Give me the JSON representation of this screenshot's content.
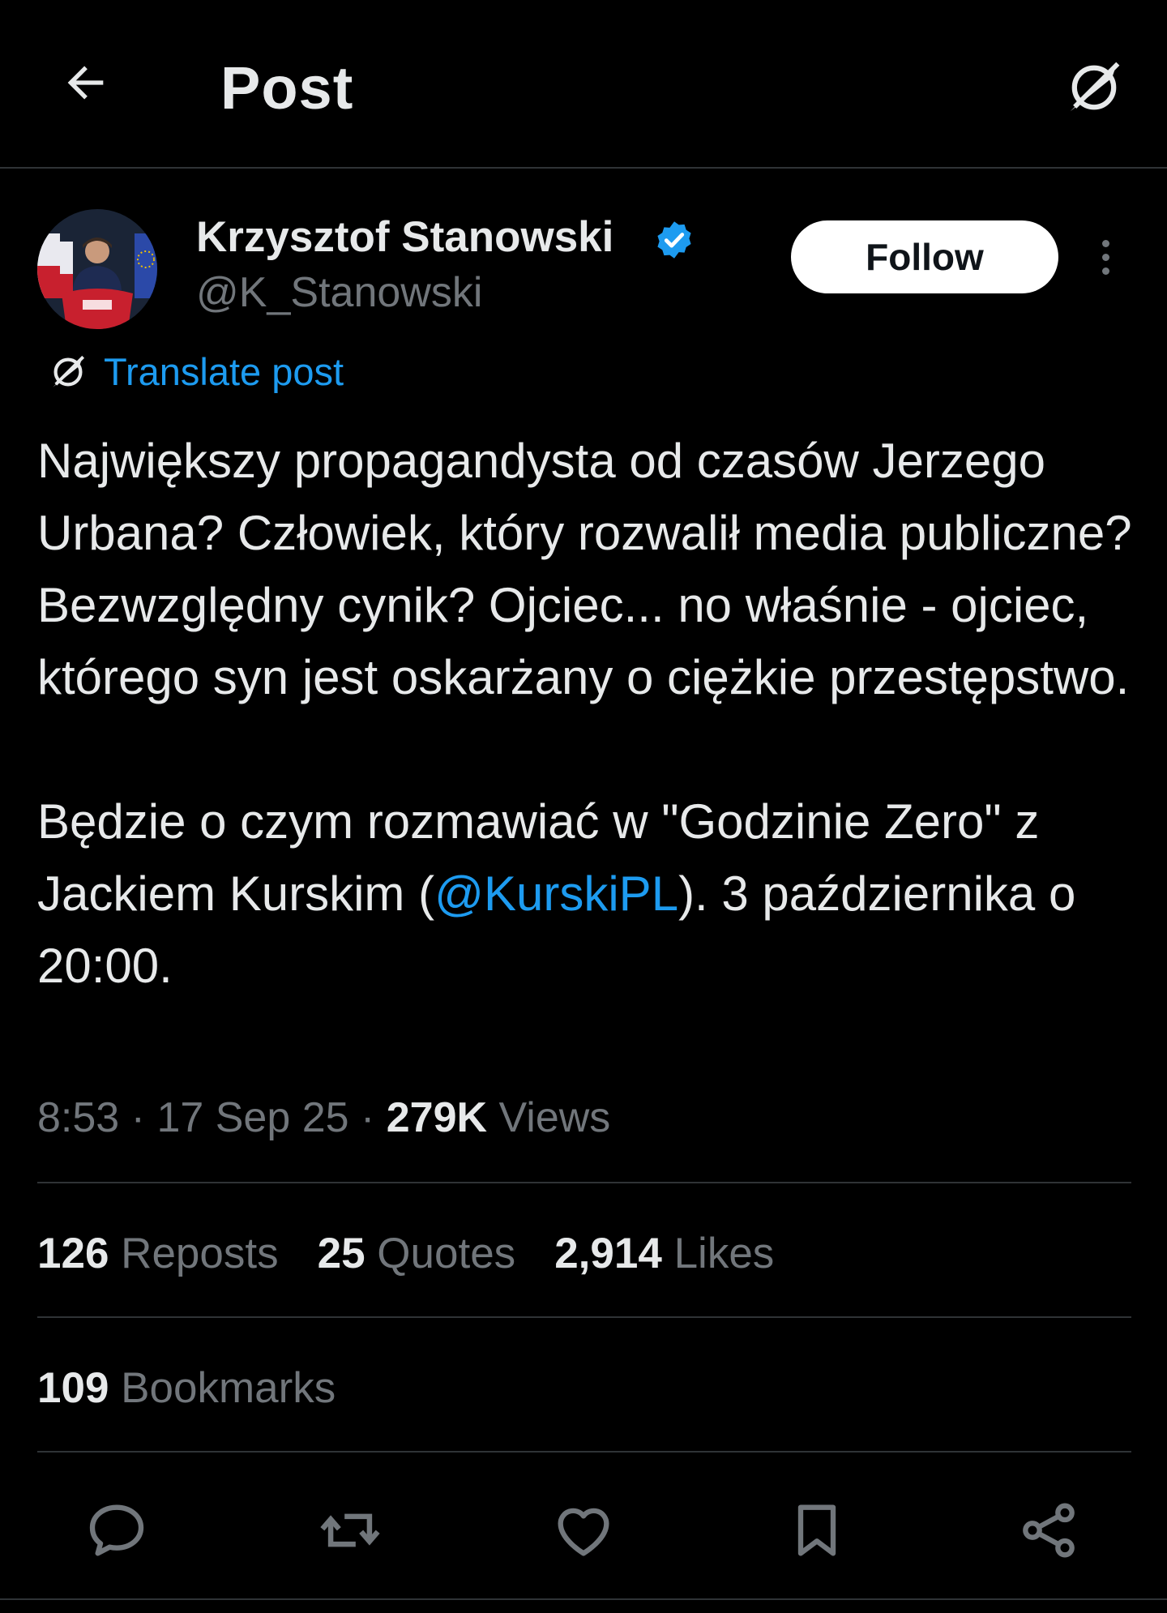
{
  "header": {
    "title": "Post",
    "back_icon": "arrow-left-icon",
    "translate_icon": "translate-icon"
  },
  "author": {
    "name": "Krzysztof Stanowski",
    "handle": "@K_Stanowski",
    "verified": true,
    "follow_label": "Follow"
  },
  "translate": {
    "label": "Translate post"
  },
  "post": {
    "paragraph_1": "Największy propagandysta od czasów Jerzego Urbana? Człowiek, który rozwalił media publiczne? Bezwzględny cynik? Ojciec... no właśnie - ojciec, którego syn jest oskarżany o ciężkie przestępstwo.",
    "paragraph_2_before": "Będzie o czym rozmawiać w \"Godzinie Zero\" z Jackiem Kurskim (",
    "mention": "@KurskiPL",
    "paragraph_2_after": "). 3 października o 20:00."
  },
  "meta": {
    "time": "8:53",
    "date": "17 Sep 25",
    "views_count": "279K",
    "views_label": "Views"
  },
  "stats": {
    "reposts_count": "126",
    "reposts_label": "Reposts",
    "quotes_count": "25",
    "quotes_label": "Quotes",
    "likes_count": "2,914",
    "likes_label": "Likes",
    "bookmarks_count": "109",
    "bookmarks_label": "Bookmarks"
  },
  "actions": [
    "reply-icon",
    "repost-icon",
    "like-icon",
    "bookmark-icon",
    "share-icon"
  ],
  "colors": {
    "background": "#000000",
    "text": "#e7e9ea",
    "muted": "#71767b",
    "link": "#1d9bf0",
    "divider": "#2f3336"
  }
}
